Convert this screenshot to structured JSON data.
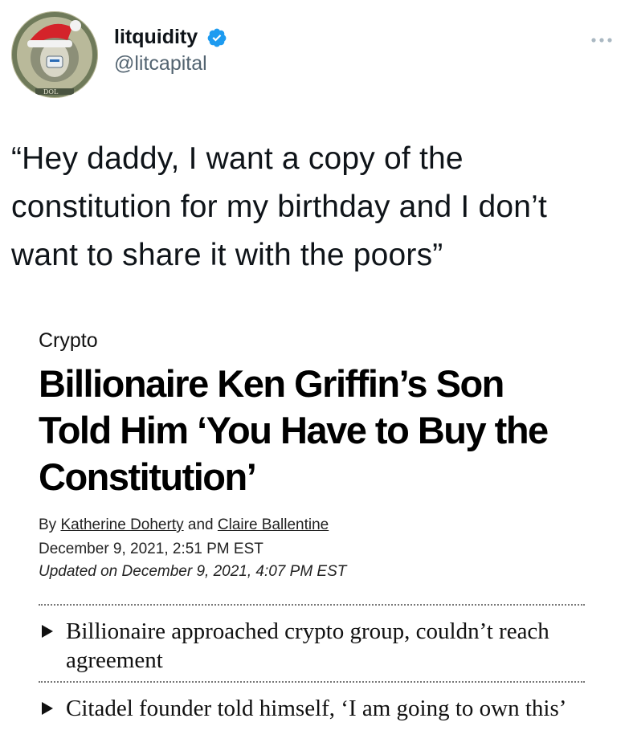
{
  "tweet": {
    "display_name": "litquidity",
    "handle": "@litcapital",
    "text": "“Hey daddy, I want a copy of the constitution for my birthday and I don’t want to share it with the poors”",
    "avatar_icon": "dollar-bill-santa-avatar",
    "verified_color": "#1d9bf0"
  },
  "article": {
    "category": "Crypto",
    "headline": "Billionaire Ken Griffin’s Son Told Him ‘You Have to Buy the Constitution’",
    "byline_prefix": "By",
    "author1": "Katherine Doherty",
    "byline_and": "and",
    "author2": "Claire Ballentine",
    "date": "December 9, 2021, 2:51 PM EST",
    "updated": "Updated on December 9, 2021, 4:07 PM EST",
    "bullets": [
      "Billionaire approached crypto group, couldn’t reach agreement",
      "Citadel founder told himself, ‘I am going to own this’"
    ]
  }
}
